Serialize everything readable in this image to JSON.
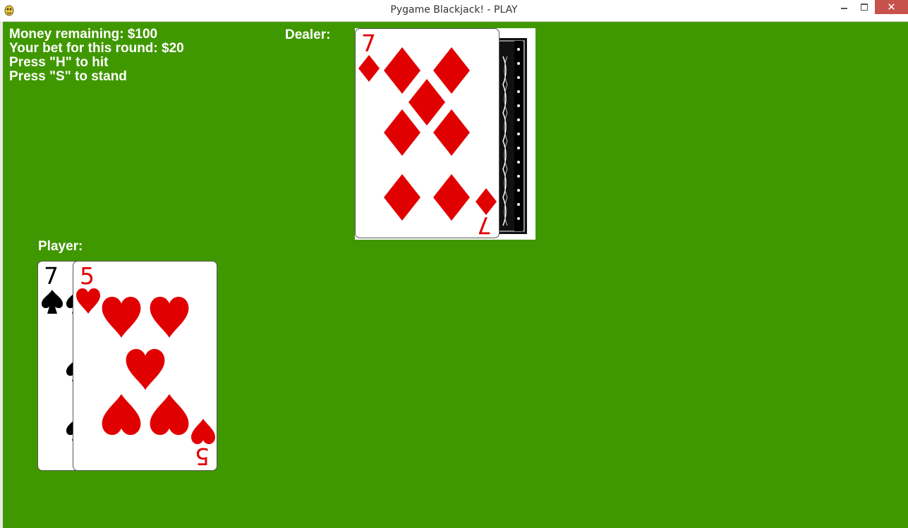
{
  "window": {
    "title": "Pygame Blackjack! - PLAY",
    "icon": "pygame-snake-icon",
    "controls": [
      "minimize",
      "maximize",
      "close"
    ]
  },
  "hud": {
    "money": "Money remaining: $100",
    "bet": "Your bet for this round: $20",
    "hit_hint": "Press \"H\" to hit",
    "stand_hint": "Press \"S\" to stand"
  },
  "dealer": {
    "label": "Dealer:",
    "cards": [
      {
        "rank": "7",
        "suit": "diamonds",
        "face_up": true
      },
      {
        "rank": "",
        "suit": "",
        "face_up": false
      }
    ]
  },
  "player": {
    "label": "Player:",
    "cards": [
      {
        "rank": "7",
        "suit": "spades",
        "face_up": true
      },
      {
        "rank": "5",
        "suit": "hearts",
        "face_up": true
      }
    ]
  },
  "colors": {
    "table": "#409800",
    "red_suit": "#e00000",
    "black_suit": "#000000",
    "text": "#ffffff"
  }
}
